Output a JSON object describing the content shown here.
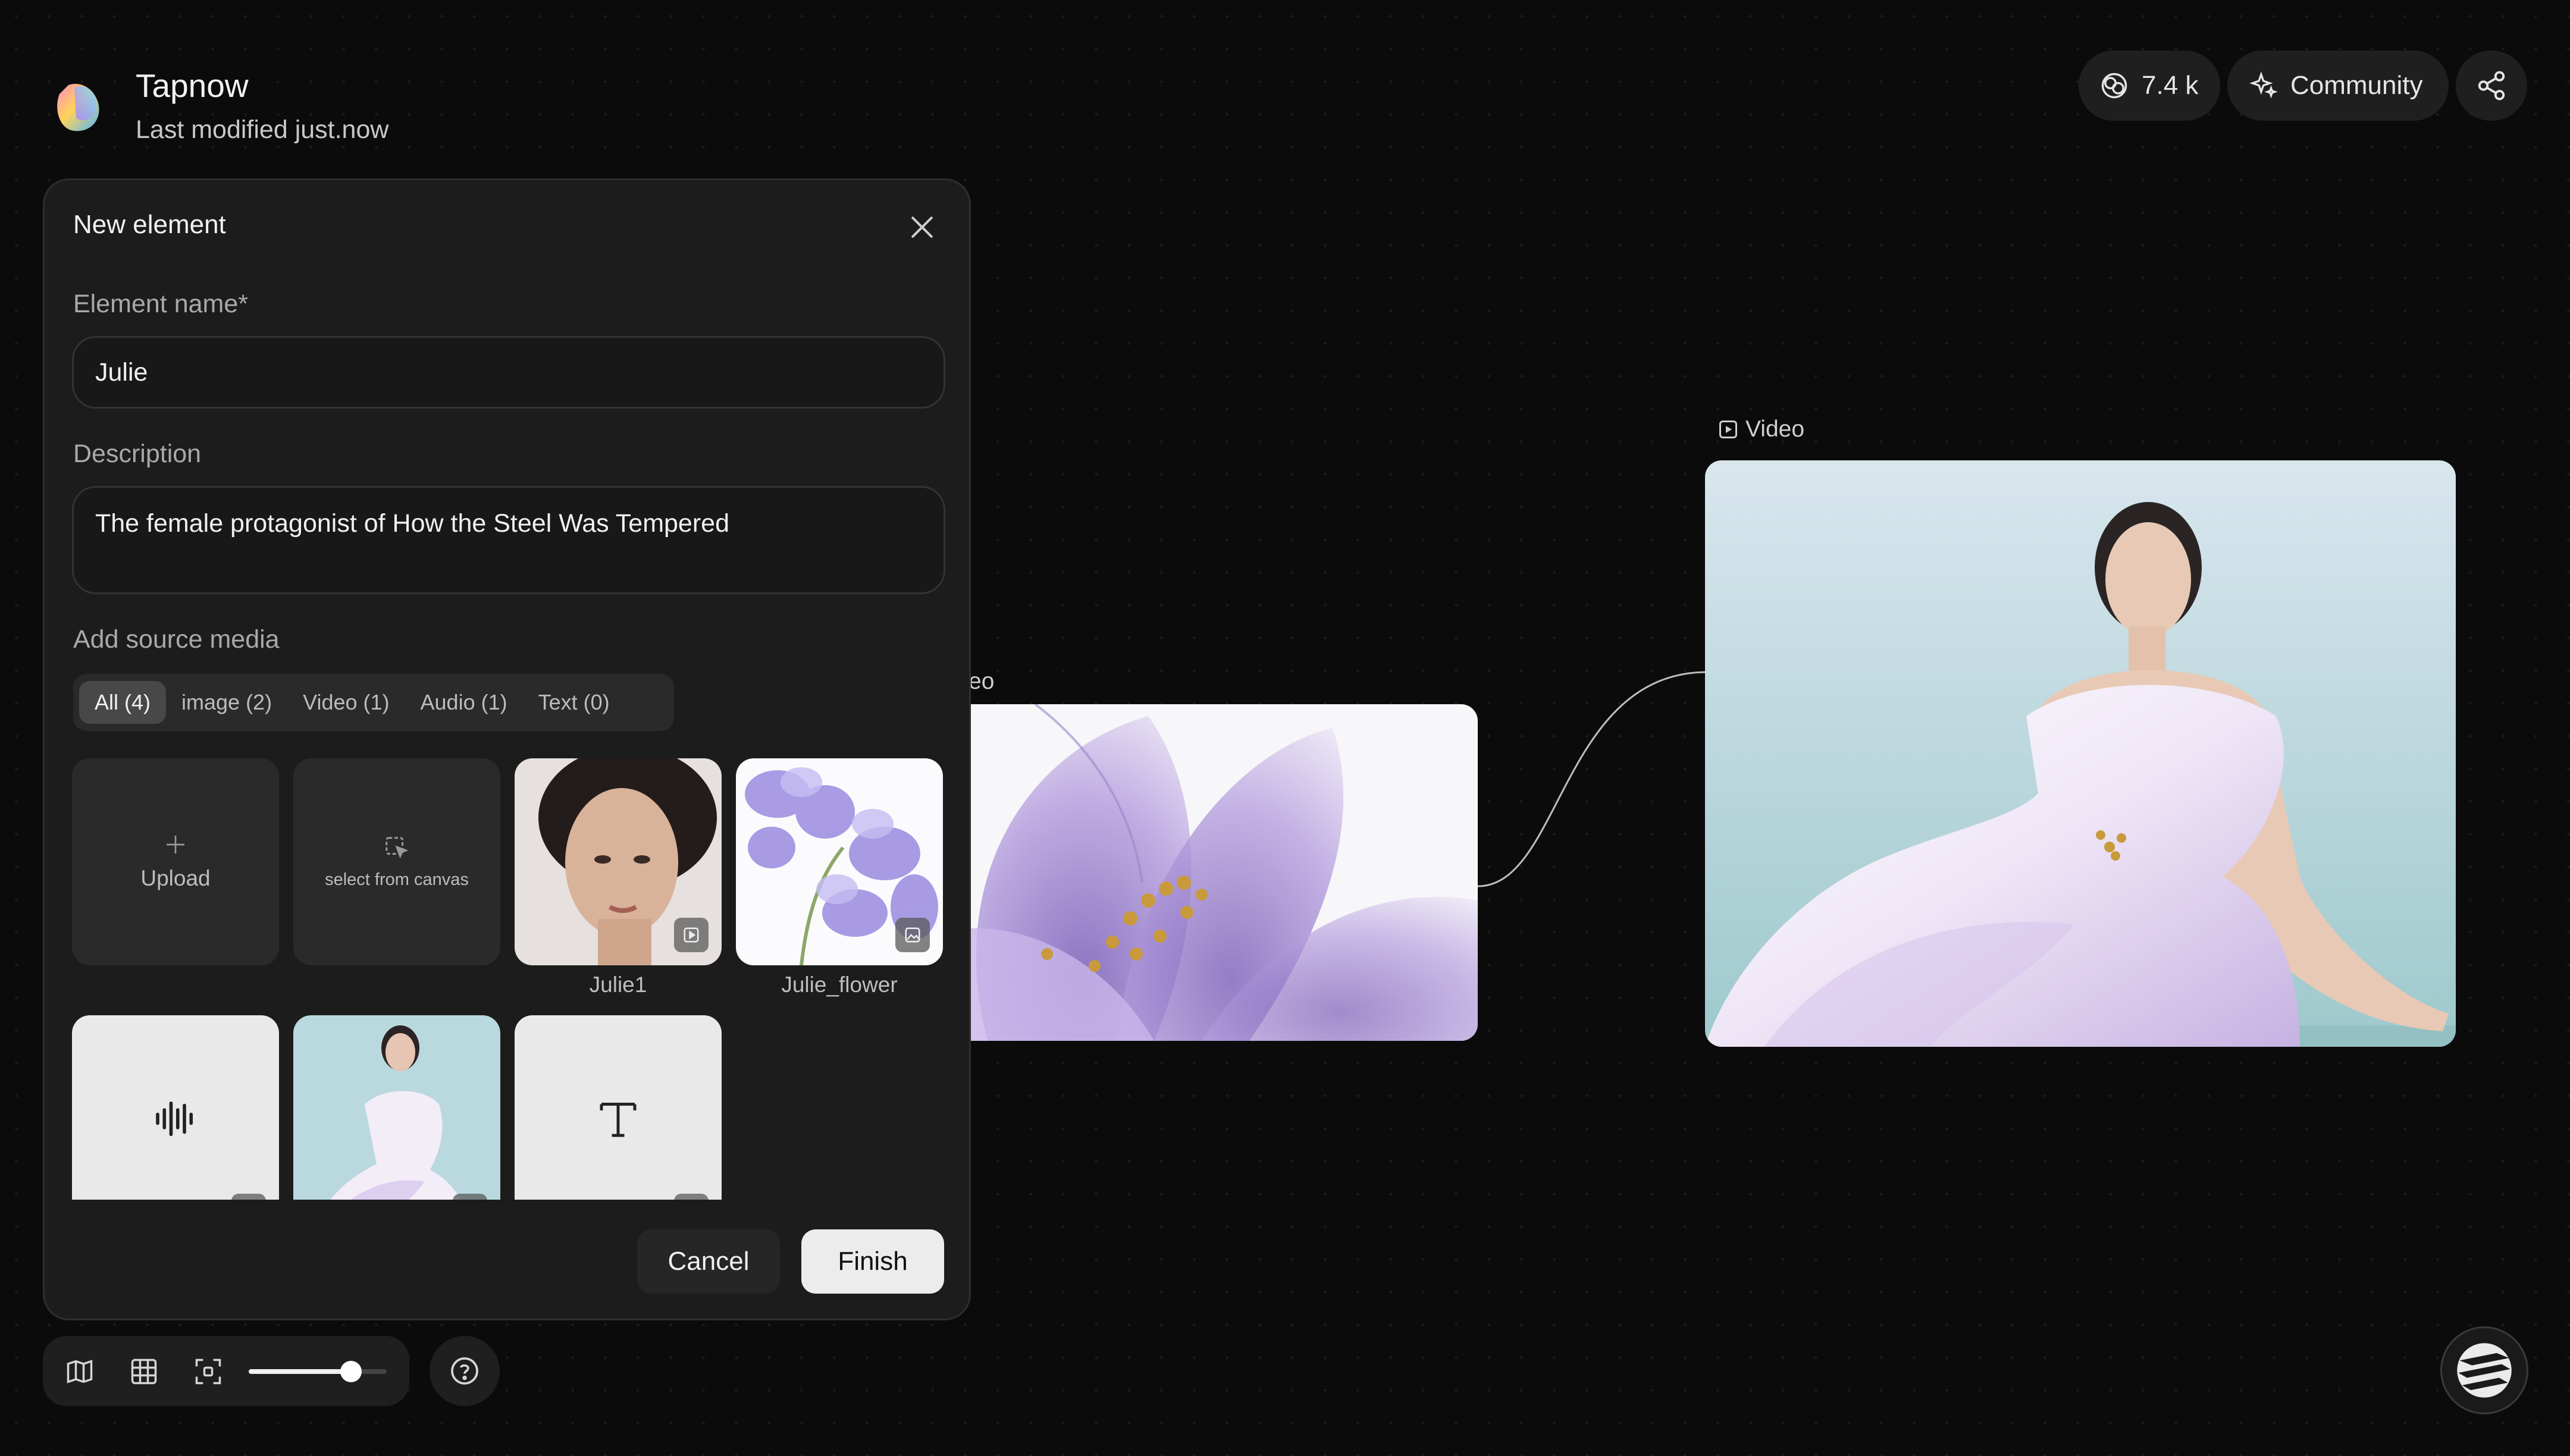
{
  "app": {
    "title": "Tapnow",
    "subtitle": "Last modified just.now"
  },
  "header": {
    "count": "7.4 k",
    "community": "Community",
    "icons": [
      "coin-icon",
      "sparkle-icon",
      "share-icon"
    ]
  },
  "canvas": {
    "flower_node_label_partial": "eo",
    "video_node_label": "Video"
  },
  "dialog": {
    "title": "New element",
    "name_label": "Element name*",
    "name_value": "Julie",
    "description_label": "Description",
    "description_value": "The female protagonist of How the Steel Was Tempered",
    "source_label": "Add source media",
    "tabs": [
      "All (4)",
      "image (2)",
      "Video (1)",
      "Audio (1)",
      "Text (0)"
    ],
    "active_tab": "All (4)",
    "upload_label": "Upload",
    "select_canvas_label": "select from canvas",
    "media": [
      {
        "caption": "Julie1",
        "kind": "video"
      },
      {
        "caption": "Julie_flower",
        "kind": "image"
      }
    ],
    "cancel": "Cancel",
    "finish": "Finish"
  },
  "toolbar": {
    "zoom_fraction": 0.74,
    "icons": [
      "map-icon",
      "grid-icon",
      "fit-screen-icon",
      "help-icon"
    ]
  }
}
